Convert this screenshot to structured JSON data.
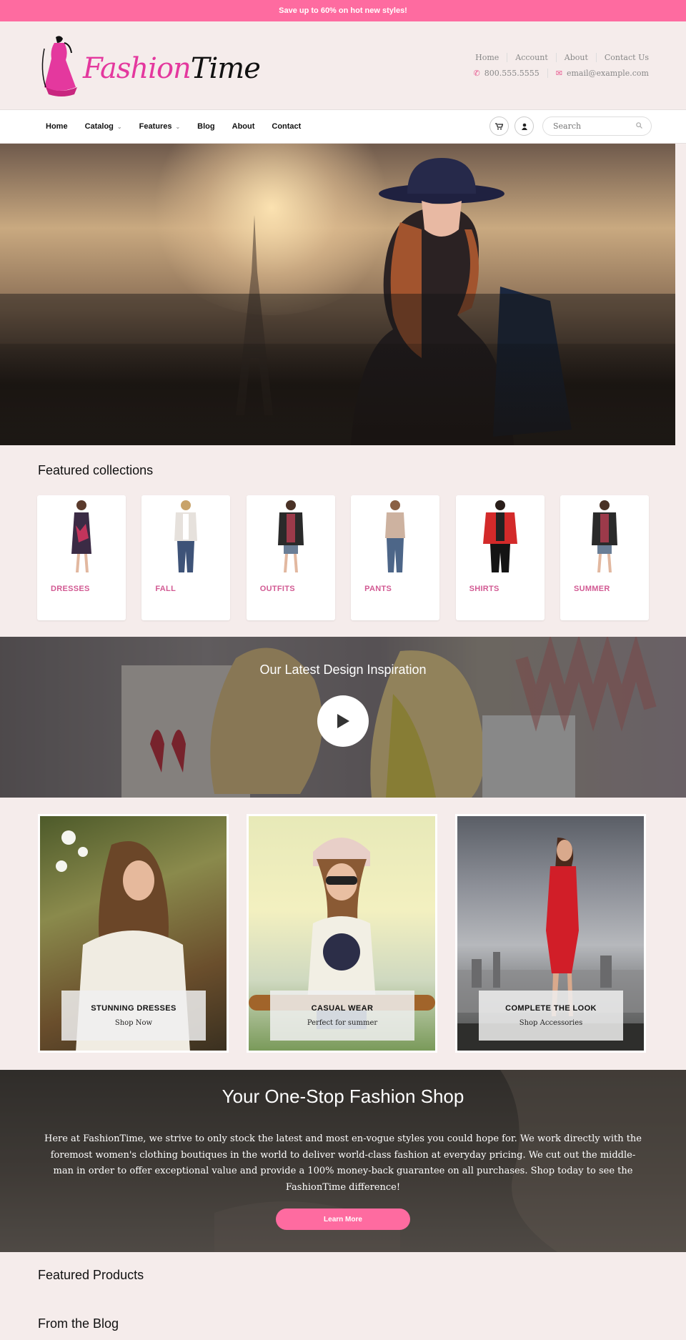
{
  "announcement": {
    "text": "Save up to 60% on hot new styles!"
  },
  "logo": {
    "part1": "Fashion",
    "part2": "Time"
  },
  "header": {
    "links": [
      "Home",
      "Account",
      "About",
      "Contact Us"
    ],
    "phone": "800.555.5555",
    "email": "email@example.com"
  },
  "nav": {
    "items": [
      {
        "label": "Home"
      },
      {
        "label": "Catalog"
      },
      {
        "label": "Features"
      },
      {
        "label": "Blog"
      },
      {
        "label": "About"
      },
      {
        "label": "Contact"
      }
    ],
    "search_placeholder": "Search"
  },
  "featured_collections": {
    "title": "Featured collections",
    "items": [
      {
        "label": "DRESSES"
      },
      {
        "label": "FALL"
      },
      {
        "label": "OUTFITS"
      },
      {
        "label": "PANTS"
      },
      {
        "label": "SHIRTS"
      },
      {
        "label": "SUMMER"
      }
    ]
  },
  "video": {
    "title": "Our Latest Design Inspiration"
  },
  "promos": [
    {
      "title": "STUNNING DRESSES",
      "subtitle": "Shop Now"
    },
    {
      "title": "CASUAL WEAR",
      "subtitle": "Perfect for summer"
    },
    {
      "title": "COMPLETE THE LOOK",
      "subtitle": "Shop Accessories"
    }
  ],
  "about": {
    "title": "Your One-Stop Fashion Shop",
    "text": "Here at FashionTime, we strive to only stock the latest and most en-vogue styles you could hope for.  We work directly with the foremost women's clothing boutiques in the world to deliver world-class fashion at everyday pricing.  We cut out the middle-man in order to offer exceptional value and provide a 100% money-back guarantee on all purchases.  Shop today to see the FashionTime difference!",
    "button": "Learn More"
  },
  "featured_products": {
    "title": "Featured Products"
  },
  "blog": {
    "title": "From the Blog"
  },
  "colors": {
    "accent": "#fe6ba0",
    "logo_pink": "#e4389e",
    "collection_label": "#d25a93",
    "background": "#f5eceb"
  }
}
